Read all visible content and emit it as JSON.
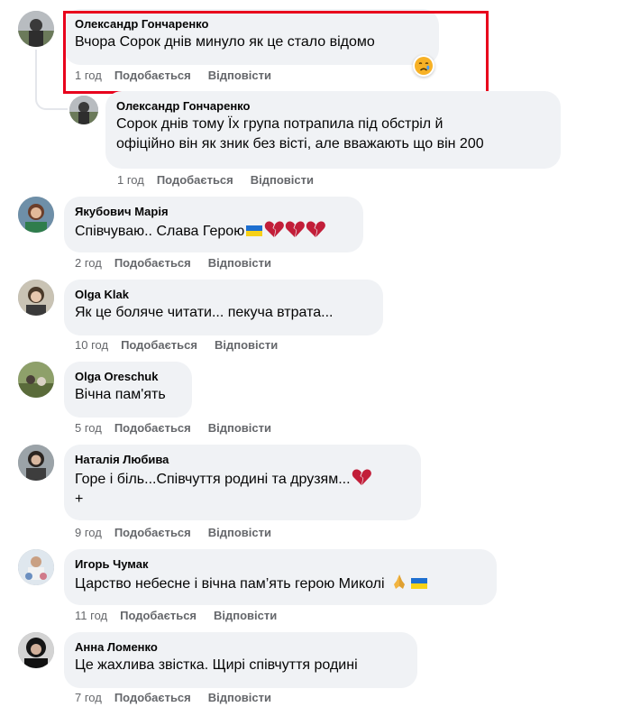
{
  "actions": {
    "like": "Подобається",
    "reply": "Відповісти"
  },
  "comments": [
    {
      "author": "Олександр Гончаренко",
      "text": "Вчора Сорок днів минуло як це стало відомо",
      "time": "1 год",
      "reaction": "crying-face"
    },
    {
      "author": "Олександр Гончаренко",
      "text_line1": "Сорок днів тому Їх група потрапила під обстріл й",
      "text_line2": "офіційно він як зник без вісті, але вважають що він 200",
      "time": "1 год"
    },
    {
      "author": "Якубович Марія",
      "text": "Співчуваю.. Слава Герою",
      "time": "2 год"
    },
    {
      "author": "Olga Klak",
      "text": "Як це боляче читати... пекуча втрата...",
      "time": "10 год"
    },
    {
      "author": "Olga Oreschuk",
      "text": "Вічна пам'ять",
      "time": "5 год"
    },
    {
      "author": "Наталія Любива",
      "text_line1": "Горе і біль...Співчуття родині та друзям...",
      "text_line2": "+",
      "time": "9 год"
    },
    {
      "author": "Игорь Чумак",
      "text": "Царство небесне і вічна пам’ять герою Миколі",
      "time": "11 год"
    },
    {
      "author": "Анна Ломенко",
      "text": "Це жахлива звістка. Щирі співчуття родині",
      "time": "7 год"
    }
  ],
  "colors": {
    "bubble": "#f0f2f5",
    "meta": "#65676b",
    "highlight": "#e8001c",
    "heart": "#c21e39"
  }
}
